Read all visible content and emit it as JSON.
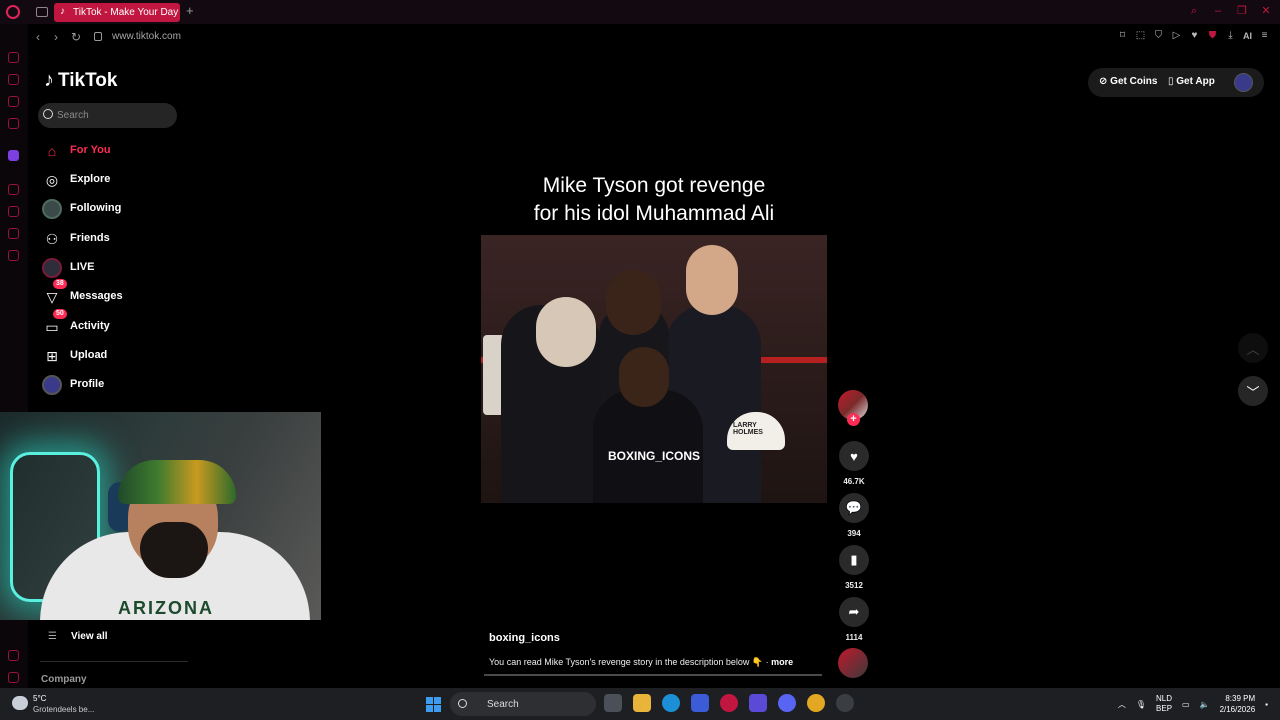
{
  "browser": {
    "tab_title": "TikTok - Make Your Day",
    "new_tab": "+",
    "url": "www.tiktok.com",
    "ai_label": "AI"
  },
  "tiktok": {
    "logo": "TikTok",
    "search_placeholder": "Search",
    "nav": [
      {
        "label": "For You",
        "icon": "home-icon",
        "active": true
      },
      {
        "label": "Explore",
        "icon": "compass-icon"
      },
      {
        "label": "Following",
        "icon": "following-avatar-icon"
      },
      {
        "label": "Friends",
        "icon": "friends-icon"
      },
      {
        "label": "LIVE",
        "icon": "live-icon"
      },
      {
        "label": "Messages",
        "icon": "messages-icon",
        "badge": "38"
      },
      {
        "label": "Activity",
        "icon": "activity-icon",
        "badge": "50"
      },
      {
        "label": "Upload",
        "icon": "upload-icon"
      },
      {
        "label": "Profile",
        "icon": "profile-icon"
      }
    ],
    "view_all": "View all",
    "company": "Company",
    "get_coins": "Get Coins",
    "get_app": "Get App"
  },
  "video": {
    "caption_line1": "Mike Tyson got revenge",
    "caption_line2": "for his idol Muhammad Ali",
    "watermark": "BOXING_ICONS",
    "cap_text": "LARRY HOLMES",
    "author": "boxing_icons",
    "description": "You can read Mike Tyson's revenge story in the description below 👇 ·",
    "more": "more",
    "likes": "46.7K",
    "comments": "394",
    "saves": "3512",
    "shares": "1114"
  },
  "webcam": {
    "shirt_text": "ARIZONA"
  },
  "taskbar": {
    "temperature": "5°C",
    "weather": "Grotendeels be...",
    "search": "Search",
    "lang_1": "NLD",
    "lang_2": "BEP",
    "time": "8:39 PM",
    "date": "2/16/2026"
  },
  "colors": {
    "accent": "#fe2c55",
    "opera_red": "#c0163f",
    "background": "#000000"
  }
}
